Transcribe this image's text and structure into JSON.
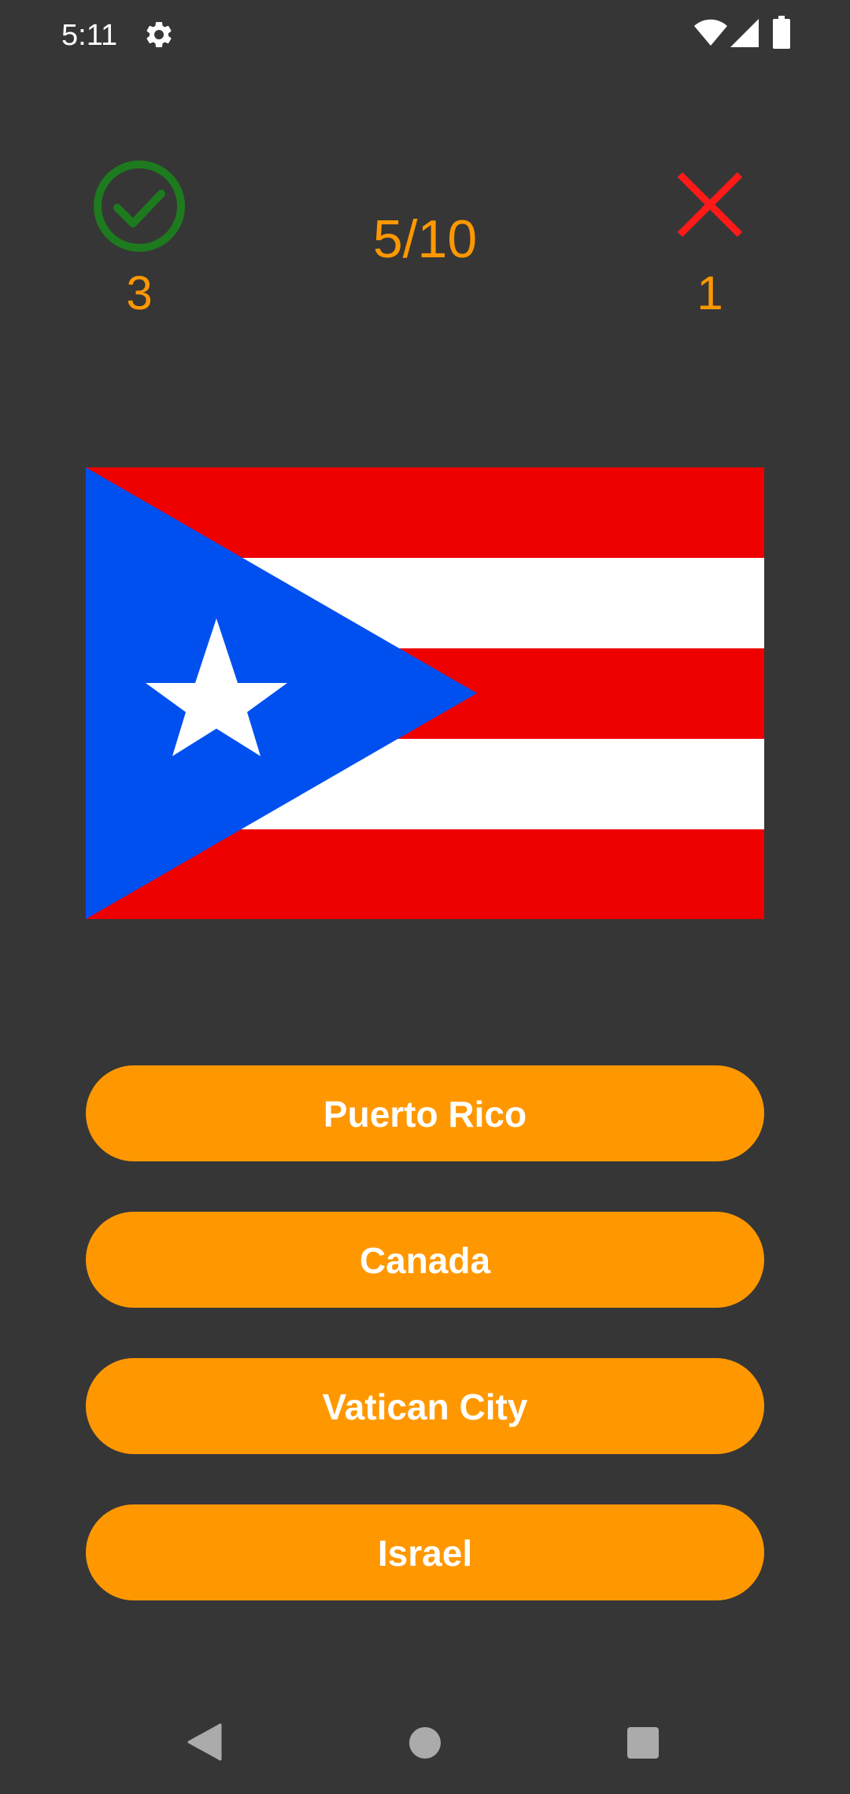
{
  "status_bar": {
    "time": "5:11",
    "icons": [
      "gear-icon",
      "wifi-icon",
      "signal-icon",
      "battery-icon"
    ]
  },
  "score": {
    "correct_count": "3",
    "wrong_count": "1",
    "progress": "5/10",
    "correct_icon": "check-circle-icon",
    "wrong_icon": "close-icon"
  },
  "flag": {
    "depicts": "puerto-rico-flag",
    "colors": {
      "red": "#ee0000",
      "white": "#ffffff",
      "blue": "#0050f0"
    }
  },
  "answers": [
    {
      "label": "Puerto Rico"
    },
    {
      "label": "Canada"
    },
    {
      "label": "Vatican City"
    },
    {
      "label": "Israel"
    }
  ],
  "nav_bar": {
    "icons": [
      "back-icon",
      "home-icon",
      "recents-icon"
    ]
  },
  "theme": {
    "background": "#363636",
    "accent": "#ff9800",
    "correct_color": "#1e7a1e",
    "wrong_color": "#ff1a1a"
  }
}
